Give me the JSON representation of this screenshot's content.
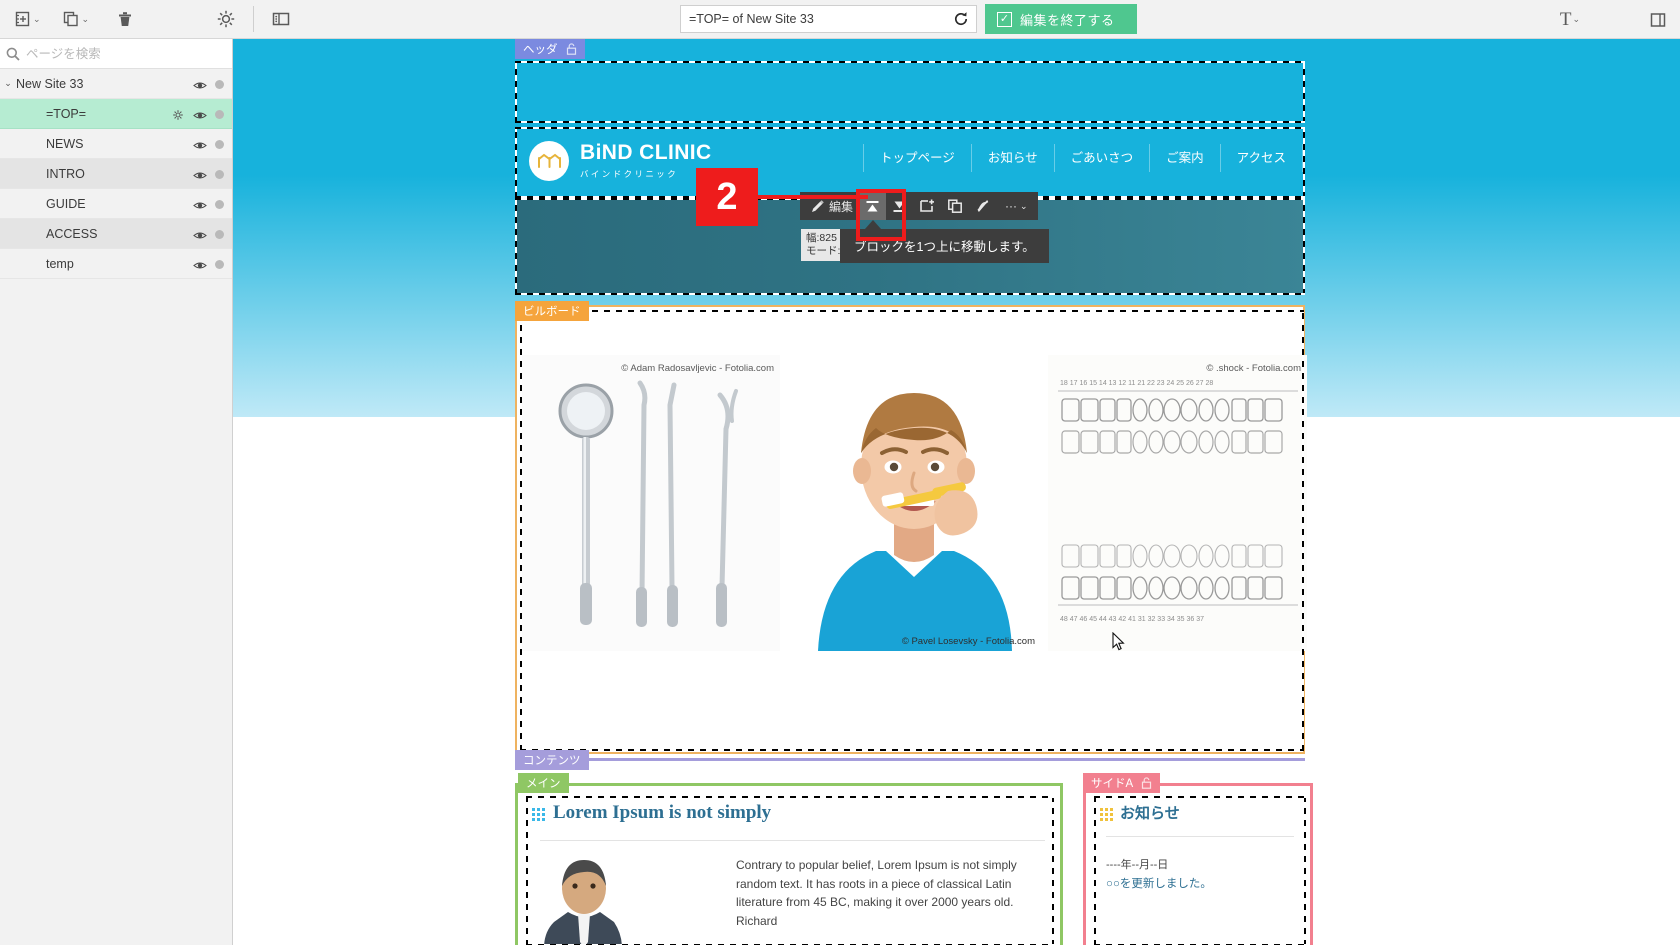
{
  "toolbar": {
    "add_page_icon": "add-page-icon",
    "duplicate_icon": "duplicate-page-icon",
    "trash_icon": "trash-icon",
    "gear_icon": "gear-icon",
    "panel_icon": "sidebar-panel-icon",
    "type_icon": "text-type-icon",
    "caret": "⌄",
    "url_value": "=TOP= of New Site 33",
    "reload_icon": "reload-icon",
    "finish_label": "編集を終了する",
    "finish_check": "✓",
    "finish_color": "#4fc78f"
  },
  "sidebar": {
    "search_placeholder": "ページを検索",
    "search_icon": "search-icon",
    "items": [
      {
        "label": "New Site 33",
        "level": 0,
        "selected": false,
        "caret": "⌄",
        "gear": false
      },
      {
        "label": "=TOP=",
        "level": 1,
        "selected": true,
        "caret": "",
        "gear": true
      },
      {
        "label": "NEWS",
        "level": 1,
        "selected": false,
        "caret": "",
        "gear": false
      },
      {
        "label": "INTRO",
        "level": 1,
        "selected": false,
        "caret": "",
        "gear": false
      },
      {
        "label": "GUIDE",
        "level": 1,
        "selected": false,
        "caret": "",
        "gear": false
      },
      {
        "label": "ACCESS",
        "level": 1,
        "selected": false,
        "caret": "",
        "gear": false
      },
      {
        "label": "temp",
        "level": 1,
        "selected": false,
        "caret": "",
        "gear": false
      }
    ],
    "selected_color": "#b6ecd2"
  },
  "canvas": {
    "chips": {
      "header": {
        "label": "ヘッダ",
        "color": "#7b8ae0",
        "lock": "unlock-icon"
      },
      "billboard": {
        "label": "ビルボード",
        "color": "#f5a43c",
        "lock": ""
      },
      "contents": {
        "label": "コンテンツ",
        "color": "#a59ddb",
        "lock": ""
      },
      "main": {
        "label": "メイン",
        "color": "#8fc764",
        "lock": ""
      },
      "sideA": {
        "label": "サイドA",
        "color": "#f2808f",
        "lock": "unlock-icon"
      }
    },
    "site": {
      "logo_title": "BiND CLINIC",
      "logo_sub": "バインドクリニック",
      "logo_icon": "clinic-tooth-logo-icon",
      "nav": [
        "トップページ",
        "お知らせ",
        "ごあいさつ",
        "ご案内",
        "アクセス"
      ],
      "header_bg": "#17b2dc"
    },
    "billboard": {
      "credits": [
        "© Adam Radosavljevic - Fotolia.com",
        "© Pavel Losevsky - Fotolia.com",
        "© .shock - Fotolia.com"
      ],
      "slides": [
        "dental-tools-photo",
        "boy-brushing-teeth-photo",
        "dental-chart-photo"
      ]
    },
    "content": {
      "main_heading": "Lorem Ipsum is not simply",
      "main_paragraph": "Contrary to popular belief, Lorem Ipsum is not simply random text. It has roots in a piece of classical Latin literature from 45 BC, making it over 2000 years old. Richard",
      "side_heading": "お知らせ",
      "news_date": "----年--月--日",
      "news_text": "○○を更新しました。"
    }
  },
  "block_toolbar": {
    "edit_icon": "pencil-icon",
    "edit_label": "編集",
    "move_up_icon": "move-block-up-icon",
    "move_down_icon": "move-block-down-icon",
    "add_block_icon": "add-block-icon",
    "copy_block_icon": "copy-block-icon",
    "hide_block_icon": "hide-block-icon",
    "more_icon": "more-options-icon",
    "more_glyph": "···",
    "caret_glyph": "⌄",
    "tooltip": "ブロックを1つ上に移動します。",
    "info_width": "幅:825",
    "info_mode": "モード:エ"
  },
  "callout": {
    "number": "2",
    "color": "#ee1c1c"
  }
}
